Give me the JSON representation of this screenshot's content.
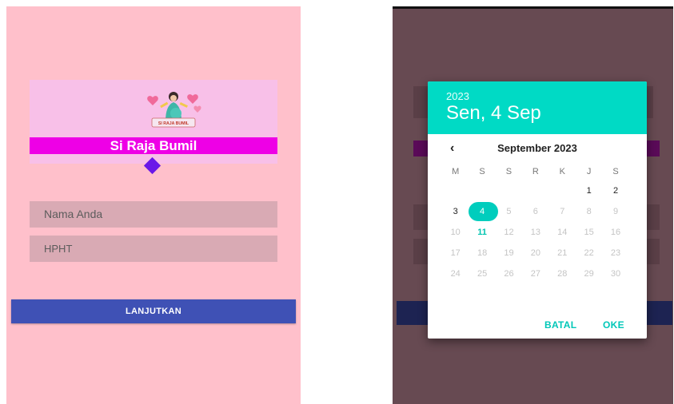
{
  "left_screen": {
    "logo": {
      "badge_text": "SI RAJA BUMIL",
      "icon": "pregnant-woman-illustration"
    },
    "app_title": "Si Raja Bumil",
    "name_field": {
      "placeholder": "Nama Anda"
    },
    "hpht_field": {
      "placeholder": "HPHT"
    },
    "submit_label": "LANJUTKAN",
    "colors": {
      "background": "#ffc0cb",
      "title_bar": "#ee00e6",
      "button": "#3f51b5",
      "diamond": "#6a18e8"
    }
  },
  "date_picker": {
    "year": "2023",
    "selected_date_label": "Sen, 4 Sep",
    "month_label": "September 2023",
    "prev_icon": "chevron-left-icon",
    "weekdays": [
      "M",
      "S",
      "S",
      "R",
      "K",
      "J",
      "S"
    ],
    "weeks": [
      [
        "",
        "",
        "",
        "",
        "",
        "1",
        "2"
      ],
      [
        "3",
        "4",
        "5",
        "6",
        "7",
        "8",
        "9"
      ],
      [
        "10",
        "11",
        "12",
        "13",
        "14",
        "15",
        "16"
      ],
      [
        "17",
        "18",
        "19",
        "20",
        "21",
        "22",
        "23"
      ],
      [
        "24",
        "25",
        "26",
        "27",
        "28",
        "29",
        "30"
      ]
    ],
    "selected_day": "4",
    "today_day": "11",
    "enabled_days": [
      "1",
      "2",
      "3",
      "4"
    ],
    "cancel_label": "BATAL",
    "ok_label": "OKE",
    "colors": {
      "header": "#00dac5",
      "accent": "#00c7b8",
      "scrim": "#674a52"
    }
  }
}
